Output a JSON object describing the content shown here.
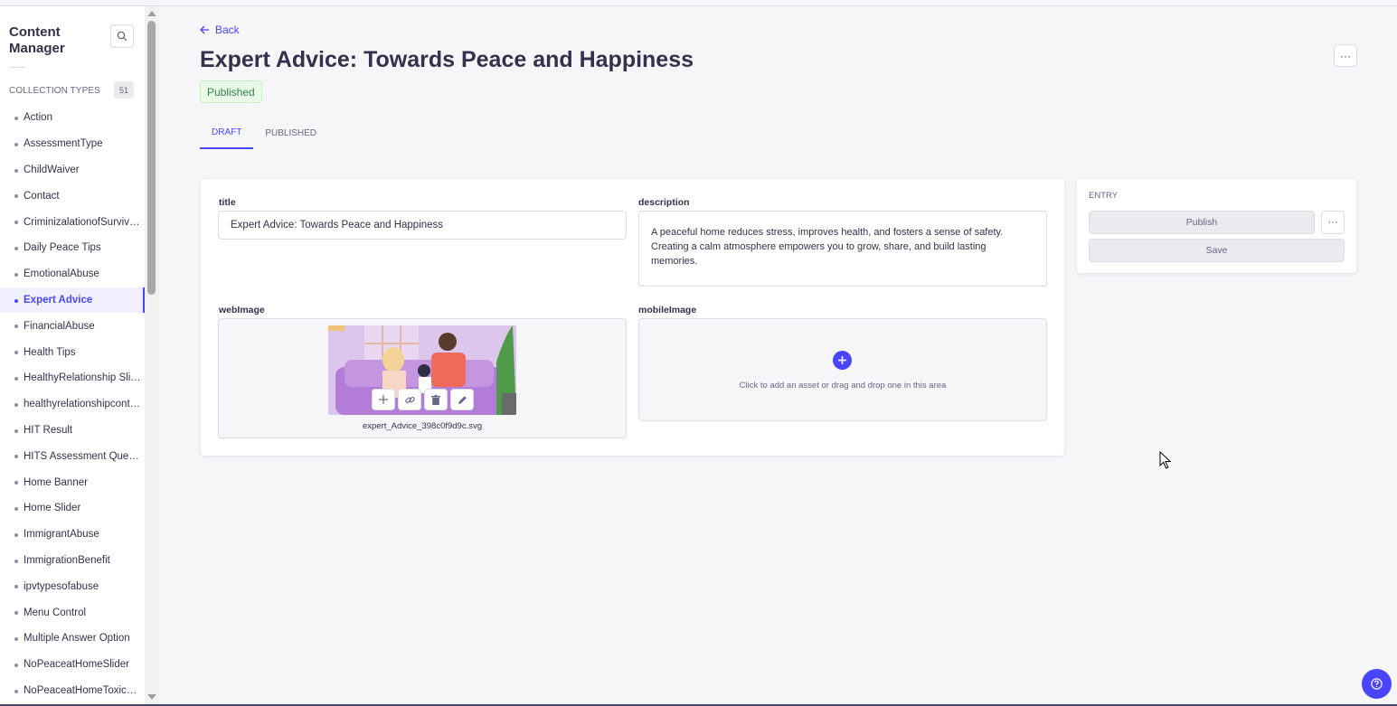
{
  "sidebar": {
    "title": "Content Manager",
    "search_icon": "search-icon",
    "section_label": "COLLECTION TYPES",
    "section_count": "51",
    "items": [
      {
        "label": "Action",
        "active": false
      },
      {
        "label": "AssessmentType",
        "active": false
      },
      {
        "label": "ChildWaiver",
        "active": false
      },
      {
        "label": "Contact",
        "active": false
      },
      {
        "label": "CriminizalationofSurvivors",
        "active": false
      },
      {
        "label": "Daily Peace Tips",
        "active": false
      },
      {
        "label": "EmotionalAbuse",
        "active": false
      },
      {
        "label": "Expert Advice",
        "active": true
      },
      {
        "label": "FinancialAbuse",
        "active": false
      },
      {
        "label": "Health Tips",
        "active": false
      },
      {
        "label": "HealthyRelationship Slider",
        "active": false
      },
      {
        "label": "healthyrelationshipcontent",
        "active": false
      },
      {
        "label": "HIT Result",
        "active": false
      },
      {
        "label": "HITS Assessment Question",
        "active": false
      },
      {
        "label": "Home Banner",
        "active": false
      },
      {
        "label": "Home Slider",
        "active": false
      },
      {
        "label": "ImmigrantAbuse",
        "active": false
      },
      {
        "label": "ImmigrationBenefit",
        "active": false
      },
      {
        "label": "ipvtypesofabuse",
        "active": false
      },
      {
        "label": "Menu Control",
        "active": false
      },
      {
        "label": "Multiple Answer Option",
        "active": false
      },
      {
        "label": "NoPeaceatHomeSlider",
        "active": false
      },
      {
        "label": "NoPeaceatHomeToxicRel...",
        "active": false
      }
    ]
  },
  "header": {
    "back_label": "Back",
    "title": "Expert Advice: Towards Peace and Happiness",
    "status": "Published",
    "more_label": "···",
    "tabs": [
      {
        "label": "DRAFT",
        "active": true
      },
      {
        "label": "PUBLISHED",
        "active": false
      }
    ]
  },
  "form": {
    "title_label": "title",
    "title_value": "Expert Advice: Towards Peace and Happiness",
    "description_label": "description",
    "description_value": "A peaceful home reduces stress, improves health, and fosters a sense of safety. Creating a calm atmosphere empowers you to grow, share, and build lasting memories.",
    "webimage_label": "webImage",
    "webimage_filename": "expert_Advice_398c0f9d9c.svg",
    "mobileimage_label": "mobileImage",
    "mobileimage_hint": "Click to add an asset or drag and drop one in this area"
  },
  "entry": {
    "title": "ENTRY",
    "publish_label": "Publish",
    "more_label": "···",
    "save_label": "Save"
  },
  "colors": {
    "accent": "#4945ff",
    "success_bg": "#eafbe7",
    "success_text": "#328048"
  }
}
